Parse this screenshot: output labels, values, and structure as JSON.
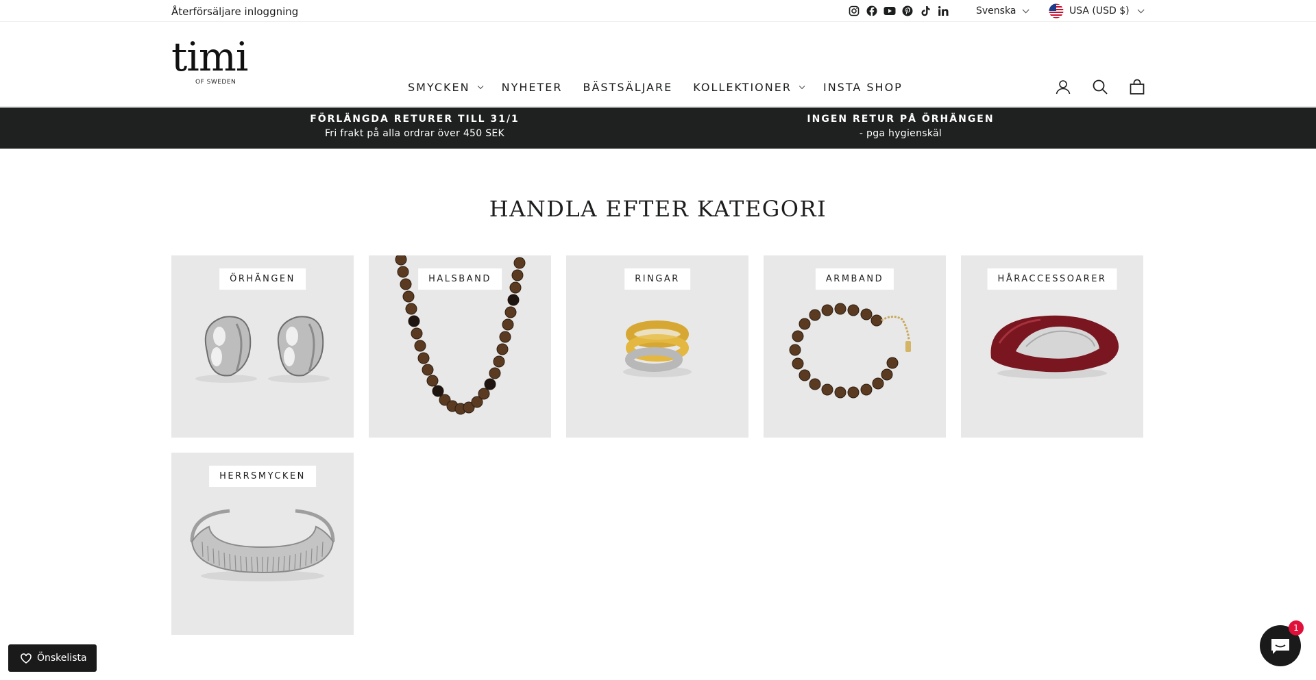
{
  "utility": {
    "reseller_login": "Återförsäljare inloggning",
    "socials": [
      "instagram-icon",
      "facebook-icon",
      "youtube-icon",
      "pinterest-icon",
      "tiktok-icon",
      "linkedin-icon"
    ],
    "language": "Svenska",
    "currency": "USA (USD $)"
  },
  "header": {
    "logo_word": "timi",
    "logo_sub": "OF SWEDEN",
    "nav": [
      {
        "label": "SMYCKEN",
        "has_dropdown": true
      },
      {
        "label": "NYHETER",
        "has_dropdown": false
      },
      {
        "label": "BÄSTSÄLJARE",
        "has_dropdown": false
      },
      {
        "label": "KOLLEKTIONER",
        "has_dropdown": true
      },
      {
        "label": "INSTA SHOP",
        "has_dropdown": false
      }
    ],
    "icons": [
      "account-icon",
      "search-icon",
      "cart-icon"
    ]
  },
  "announcement": [
    {
      "title": "FÖRLÄNGDA RETURER TILL 31/1",
      "subtitle": "Fri frakt på alla ordrar över 450 SEK"
    },
    {
      "title": "INGEN RETUR PÅ ÖRHÄNGEN",
      "subtitle": "- pga hygienskäl"
    }
  ],
  "section": {
    "title": "HANDLA EFTER KATEGORI",
    "categories": [
      {
        "label": "ÖRHÄNGEN"
      },
      {
        "label": "HALSBAND"
      },
      {
        "label": "RINGAR"
      },
      {
        "label": "ARMBAND"
      },
      {
        "label": "HÅRACCESSOARER"
      },
      {
        "label": "HERRSMYCKEN"
      }
    ]
  },
  "wishlist": {
    "label": "Önskelista"
  },
  "chat": {
    "badge": "1"
  },
  "colors": {
    "announcement_bg": "#1f2020",
    "card_bg": "#e8e8e8",
    "badge": "#e0103a"
  }
}
